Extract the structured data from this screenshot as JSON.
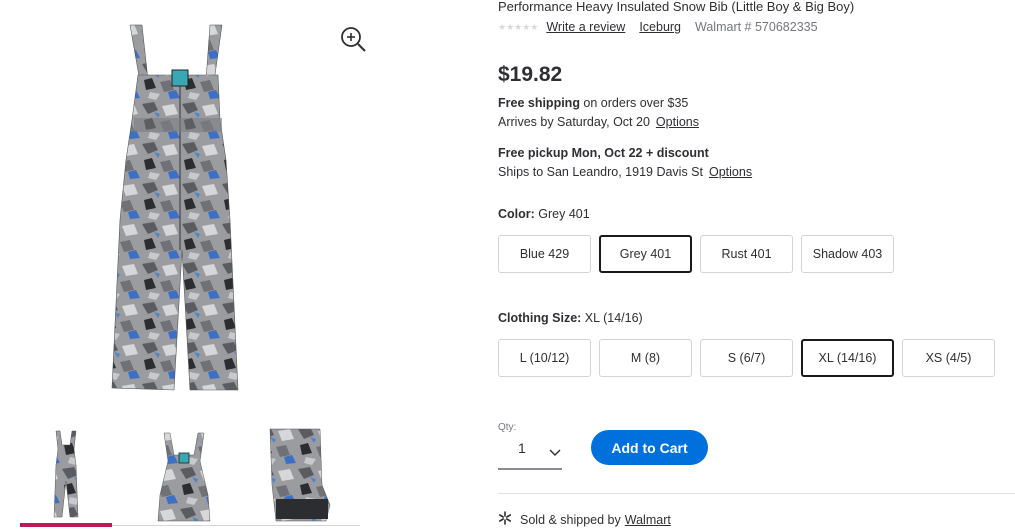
{
  "product": {
    "title": "Performance Heavy Insulated Snow Bib (Little Boy & Big Boy)",
    "stars": "★★★★★",
    "write_review": "Write a review",
    "brand": "Iceburg",
    "item_number": "Walmart # 570682335",
    "price": "$19.82"
  },
  "shipping": {
    "free_shipping": "Free shipping",
    "orders_over": " on orders over $35",
    "arrives": "Arrives by Saturday, Oct 20",
    "options_link": "Options"
  },
  "pickup": {
    "headline": "Free pickup Mon, Oct 22 + discount",
    "ships_to": "Ships to San Leandro, 1919 Davis St",
    "options_link": "Options"
  },
  "color": {
    "label": "Color:",
    "selected": " Grey 401",
    "options": [
      "Blue 429",
      "Grey 401",
      "Rust 401",
      "Shadow 403"
    ],
    "selected_index": 1
  },
  "size": {
    "label": "Clothing Size:",
    "selected": " XL (14/16)",
    "options": [
      "L (10/12)",
      "M (8)",
      "S (6/7)",
      "XL (14/16)",
      "XS (4/5)"
    ],
    "selected_index": 3
  },
  "cart": {
    "qty_label": "Qty:",
    "qty_value": "1",
    "add_to_cart": "Add to Cart"
  },
  "seller": {
    "sold_by": "Sold & shipped by",
    "seller_name": "Walmart"
  },
  "colors": {
    "accent_blue": "#0071dc",
    "thumb_active": "#c2185b"
  }
}
